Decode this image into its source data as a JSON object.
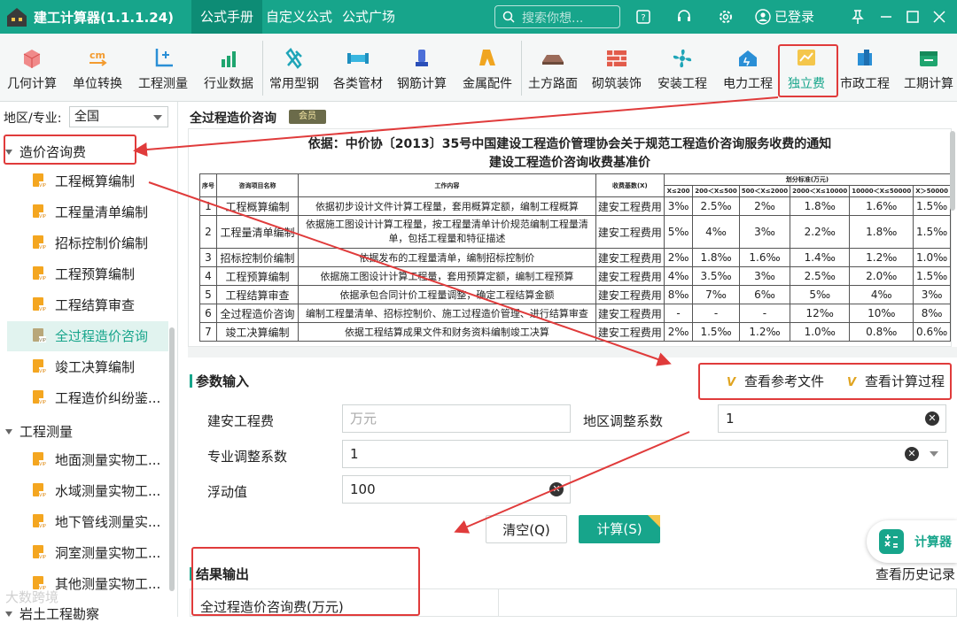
{
  "app": {
    "title": "建工计算器(1.1.1.24)",
    "login": "已登录",
    "search_placeholder": "搜索你想..."
  },
  "nav_tabs": [
    "公式手册",
    "自定义公式",
    "公式广场"
  ],
  "toolbar": [
    "几何计算",
    "单位转换",
    "工程测量",
    "行业数据",
    "常用型钢",
    "各类管材",
    "钢筋计算",
    "金属配件",
    "土方路面",
    "砌筑装饰",
    "安装工程",
    "电力工程",
    "独立费",
    "市政工程",
    "工期计算"
  ],
  "sidebar": {
    "region_label": "地区/专业:",
    "region_value": "全国",
    "group1": "造价咨询费",
    "group1_items": [
      "工程概算编制",
      "工程量清单编制",
      "招标控制价编制",
      "工程预算编制",
      "工程结算审查",
      "全过程造价咨询",
      "竣工决算编制",
      "工程造价纠纷鉴..."
    ],
    "group2": "工程测量",
    "group2_items": [
      "地面测量实物工...",
      "水域测量实物工...",
      "地下管线测量实...",
      "洞室测量实物工...",
      "其他测量实物工..."
    ],
    "group3": "岩土工程勘察"
  },
  "main": {
    "title": "全过程造价咨询",
    "vip": "会员",
    "doc_title1": "依据：中价协〔2013〕35号中国建设工程造价管理协会关于规范工程造价咨询服务收费的通知",
    "doc_title2": "建设工程造价咨询收费基准价",
    "table_headers": [
      "序号",
      "咨询项目名称",
      "工作内容",
      "收费基数(X)",
      "划分标准(万元)"
    ],
    "table_subheaders": [
      "X≤200",
      "200＜X≤500",
      "500＜X≤2000",
      "2000＜X≤10000",
      "10000＜X≤50000",
      "X＞50000"
    ],
    "table_rows": [
      {
        "no": "1",
        "name": "工程概算编制",
        "work": "依据初步设计文件计算工程量，套用概算定额，编制工程概算",
        "base": "建安工程费用",
        "rates": [
          "3‰",
          "2.5‰",
          "2‰",
          "1.8‰",
          "1.6‰",
          "1.5‰"
        ]
      },
      {
        "no": "2",
        "name": "工程量清单编制",
        "work": "依据施工图设计计算工程量，按工程量清单计价规范编制工程量清单，包括工程量和特征描述",
        "base": "建安工程费用",
        "rates": [
          "5‰",
          "4‰",
          "3‰",
          "2.2‰",
          "1.8‰",
          "1.5‰"
        ]
      },
      {
        "no": "3",
        "name": "招标控制价编制",
        "work": "依据发布的工程量清单，编制招标控制价",
        "base": "建安工程费用",
        "rates": [
          "2‰",
          "1.8‰",
          "1.6‰",
          "1.4‰",
          "1.2‰",
          "1.0‰"
        ]
      },
      {
        "no": "4",
        "name": "工程预算编制",
        "work": "依据施工图设计计算工程量，套用预算定额，编制工程预算",
        "base": "建安工程费用",
        "rates": [
          "4‰",
          "3.5‰",
          "3‰",
          "2.5‰",
          "2.0‰",
          "1.5‰"
        ]
      },
      {
        "no": "5",
        "name": "工程结算审查",
        "work": "依据承包合同计价工程量调整，确定工程结算金额",
        "base": "建安工程费用",
        "rates": [
          "8‰",
          "7‰",
          "6‰",
          "5‰",
          "4‰",
          "3‰"
        ]
      },
      {
        "no": "6",
        "name": "全过程造价咨询",
        "work": "编制工程量清单、招标控制价、施工过程造价管理、进行结算审查",
        "base": "建安工程费用",
        "rates": [
          "-",
          "-",
          "-",
          "12‰",
          "10‰",
          "8‰"
        ]
      },
      {
        "no": "7",
        "name": "竣工决算编制",
        "work": "依据工程结算成果文件和财务资料编制竣工决算",
        "base": "建安工程费用",
        "rates": [
          "2‰",
          "1.5‰",
          "1.2‰",
          "1.0‰",
          "0.8‰",
          "0.6‰"
        ]
      }
    ]
  },
  "params": {
    "section": "参数输入",
    "view_ref": "查看参考文件",
    "view_process": "查看计算过程",
    "f1_label": "建安工程费",
    "f1_placeholder": "万元",
    "f2_label": "地区调整系数",
    "f2_value": "1",
    "f3_label": "专业调整系数",
    "f3_value": "1",
    "f4_label": "浮动值",
    "f4_value": "100",
    "clear_btn": "清空(Q)",
    "calc_btn": "计算(S)"
  },
  "result": {
    "section": "结果输出",
    "history": "查看历史记录",
    "row_label": "全过程造价咨询费(万元)"
  },
  "float_calc": "计算器",
  "watermark": "大数跨境",
  "colors": {
    "brand": "#17a58b",
    "highlight": "#e03b3b"
  }
}
